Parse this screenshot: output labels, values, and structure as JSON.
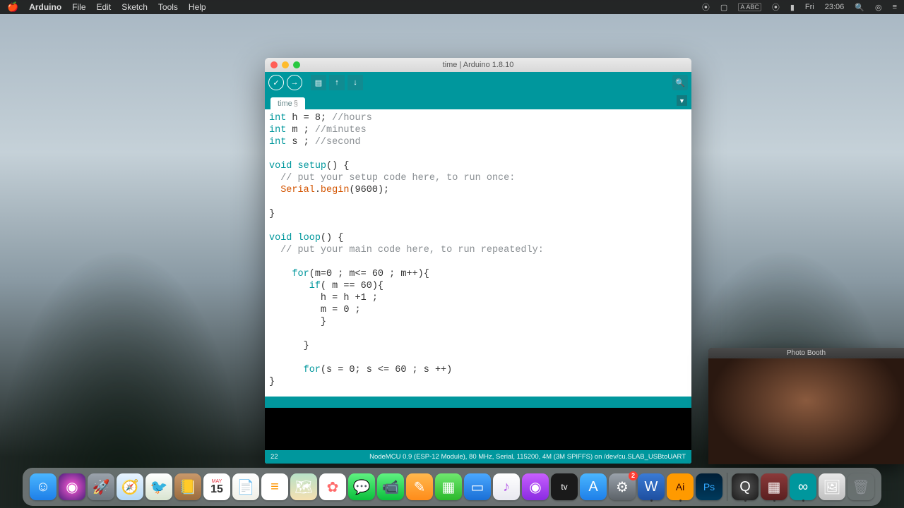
{
  "menubar": {
    "app": "Arduino",
    "items": [
      "File",
      "Edit",
      "Sketch",
      "Tools",
      "Help"
    ],
    "input_lang": "ABC",
    "day": "Fri",
    "time": "23:06"
  },
  "ide": {
    "window_title": "time | Arduino 1.8.10",
    "tab_name": "time",
    "tab_modified": "§",
    "toolbar": {
      "verify": "verify-icon",
      "upload": "upload-icon",
      "new": "new-icon",
      "open": "open-icon",
      "save": "save-icon",
      "monitor": "serial-monitor-icon"
    },
    "code": {
      "l1_a": "int",
      "l1_b": " h = 8; ",
      "l1_c": "//hours",
      "l2_a": "int",
      "l2_b": " m ; ",
      "l2_c": "//minutes",
      "l3_a": "int",
      "l3_b": " s ; ",
      "l3_c": "//second",
      "l4": "",
      "l5_a": "void",
      "l5_b": " ",
      "l5_c": "setup",
      "l5_d": "() {",
      "l6": "  // put your setup code here, to run once:",
      "l7_a": "  ",
      "l7_b": "Serial",
      "l7_c": ".",
      "l7_d": "begin",
      "l7_e": "(9600);",
      "l8": "  ",
      "l9": "}",
      "l10": "",
      "l11_a": "void",
      "l11_b": " ",
      "l11_c": "loop",
      "l11_d": "() {",
      "l12": "  // put your main code here, to run repeatedly:",
      "l13": "",
      "l14_a": "    ",
      "l14_b": "for",
      "l14_c": "(m=0 ; m<= 60 ; m++){",
      "l15_a": "       ",
      "l15_b": "if",
      "l15_c": "( m == 60){",
      "l16": "         h = h +1 ;",
      "l17": "         m = 0 ;",
      "l18": "         }",
      "l19": "      ",
      "l20": "      }",
      "l21": "",
      "l22_a": "      ",
      "l22_b": "for",
      "l22_c": "(s = 0; s <= 60 ; s ++)",
      "l23": "}"
    },
    "status_line": "22",
    "status_board": "NodeMCU 0.9 (ESP-12 Module), 80 MHz, Serial, 115200, 4M (3M SPIFFS) on /dev/cu.SLAB_USBtoUART"
  },
  "photobooth": {
    "title": "Photo Booth"
  },
  "dock": {
    "items": [
      {
        "name": "finder",
        "bg": "linear-gradient(#4ab6ff,#1e7fe8)",
        "glyph": "☺"
      },
      {
        "name": "siri",
        "bg": "radial-gradient(circle,#ff5bd7,#4a1f7a)",
        "glyph": "◉"
      },
      {
        "name": "launchpad",
        "bg": "linear-gradient(#9aa2ab,#6c757d)",
        "glyph": "🚀"
      },
      {
        "name": "safari",
        "bg": "linear-gradient(#e8f4ff,#b5d8f5)",
        "glyph": "🧭"
      },
      {
        "name": "mail",
        "bg": "linear-gradient(#fff,#d9e4d0)",
        "glyph": "🐦"
      },
      {
        "name": "contacts",
        "bg": "linear-gradient(#c9986a,#9a6c3e)",
        "glyph": "📒"
      },
      {
        "name": "calendar",
        "bg": "#fff",
        "glyph": "15",
        "text": "#e63946",
        "label": "MAY"
      },
      {
        "name": "notes",
        "bg": "linear-gradient(#fff,#f0f0e8)",
        "glyph": "📄"
      },
      {
        "name": "reminders",
        "bg": "#fff",
        "glyph": "≡",
        "text": "#ff9500"
      },
      {
        "name": "maps",
        "bg": "linear-gradient(#b8e2c8,#f5e0b0)",
        "glyph": "🗺"
      },
      {
        "name": "photos",
        "bg": "#fff",
        "glyph": "✿",
        "text": "#ff6b6b"
      },
      {
        "name": "messages",
        "bg": "linear-gradient(#5ff281,#0bbf3c)",
        "glyph": "💬"
      },
      {
        "name": "facetime",
        "bg": "linear-gradient(#5ff281,#0bbf3c)",
        "glyph": "📹"
      },
      {
        "name": "pages",
        "bg": "linear-gradient(#ffb84d,#ff8c1a)",
        "glyph": "✎"
      },
      {
        "name": "numbers",
        "bg": "linear-gradient(#6fe86f,#2bb82b)",
        "glyph": "▦"
      },
      {
        "name": "keynote",
        "bg": "linear-gradient(#4aa8ff,#1a6fd6)",
        "glyph": "▭"
      },
      {
        "name": "itunes",
        "bg": "linear-gradient(#fff,#e8e8f0)",
        "glyph": "♪",
        "text": "#b85fe8"
      },
      {
        "name": "podcasts",
        "bg": "linear-gradient(#c85fff,#8a2be2)",
        "glyph": "◉"
      },
      {
        "name": "tv",
        "bg": "#1a1a1a",
        "glyph": "tv",
        "text": "#fff",
        "fs": "12px"
      },
      {
        "name": "appstore",
        "bg": "linear-gradient(#4ab6ff,#1e7fe8)",
        "glyph": "A"
      },
      {
        "name": "preferences",
        "bg": "linear-gradient(#9aa2ab,#5c6268)",
        "glyph": "⚙",
        "badge": "2"
      },
      {
        "name": "word",
        "bg": "linear-gradient(#3a7bd5,#1e4fa0)",
        "glyph": "W",
        "running": true
      },
      {
        "name": "illustrator",
        "bg": "#ff9a00",
        "glyph": "Ai",
        "text": "#330000",
        "fs": "14px",
        "running": true
      },
      {
        "name": "photoshop",
        "bg": "linear-gradient(#001e36,#003a5c)",
        "glyph": "Ps",
        "text": "#31a8ff",
        "fs": "14px"
      }
    ],
    "after_sep": [
      {
        "name": "quicktime",
        "bg": "radial-gradient(#555,#1a1a1a)",
        "glyph": "Q",
        "running": true
      },
      {
        "name": "photobooth",
        "bg": "linear-gradient(#8b3a3a,#5a1f1f)",
        "glyph": "▦",
        "running": true
      },
      {
        "name": "arduino",
        "bg": "#00979d",
        "glyph": "∞",
        "running": true
      },
      {
        "name": "preview",
        "bg": "linear-gradient(#e8e8e8,#c0c0c0)",
        "glyph": "🖼"
      },
      {
        "name": "trash",
        "bg": "transparent",
        "glyph": "🗑",
        "text": "#8a8f93"
      }
    ]
  }
}
